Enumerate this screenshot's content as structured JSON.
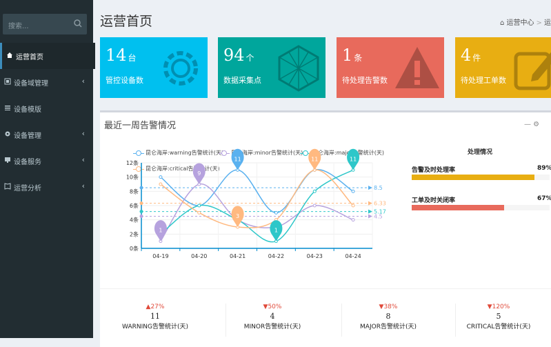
{
  "sidebar": {
    "search_placeholder": "搜索...",
    "items": [
      {
        "label": "运营首页",
        "icon": "home-icon",
        "chevron": ""
      },
      {
        "label": "设备域管理",
        "icon": "network-icon",
        "chevron": "‹"
      },
      {
        "label": "设备模版",
        "icon": "list-icon",
        "chevron": ""
      },
      {
        "label": "设备管理",
        "icon": "gear-icon",
        "chevron": "‹"
      },
      {
        "label": "设备服务",
        "icon": "monitor-icon",
        "chevron": "‹"
      },
      {
        "label": "运营分析",
        "icon": "book-icon",
        "chevron": "‹"
      }
    ]
  },
  "header": {
    "title": "运营首页",
    "breadcrumb": {
      "home": "运营中心",
      "sep": ">",
      "current": "运营"
    }
  },
  "stat_boxes": [
    {
      "num": "14",
      "unit": "台",
      "label": "管控设备数",
      "color": "#00c0ef",
      "icon": "gear-icon"
    },
    {
      "num": "94",
      "unit": "个",
      "label": "数据采集点",
      "color": "#00a69c",
      "icon": "polygon-icon"
    },
    {
      "num": "1",
      "unit": "条",
      "label": "待处理告警数",
      "color": "#e86a5c",
      "icon": "warning-icon"
    },
    {
      "num": "4",
      "unit": "件",
      "label": "待处理工单数",
      "color": "#e8ae12",
      "icon": "edit-icon"
    }
  ],
  "panel": {
    "title": "最近一周告警情况",
    "tools": "—  ⚙"
  },
  "progress": {
    "title": "处理情况",
    "items": [
      {
        "label": "告警及时处理率",
        "value": "89%",
        "fraction": 0.89,
        "color": "#e8ae12"
      },
      {
        "label": "工单及时关闭率",
        "value": "67%",
        "fraction": 0.67,
        "color": "#e86a5c"
      }
    ]
  },
  "stats": [
    {
      "pct": "▲27%",
      "pct_color": "#e04a3a",
      "value": "11",
      "name": "WARNING告警统计(天)"
    },
    {
      "pct": "▼50%",
      "pct_color": "#e04a3a",
      "value": "4",
      "name": "MINOR告警统计(天)"
    },
    {
      "pct": "▼38%",
      "pct_color": "#e04a3a",
      "value": "8",
      "name": "MAJOR告警统计(天)"
    },
    {
      "pct": "▼120%",
      "pct_color": "#e04a3a",
      "value": "5",
      "name": "CRITICAL告警统计(天)"
    }
  ],
  "chart_data": {
    "type": "line",
    "categories": [
      "04-19",
      "04-20",
      "04-21",
      "04-22",
      "04-23",
      "04-24"
    ],
    "ylim": [
      0,
      12
    ],
    "yticks": [
      "0条",
      "2条",
      "4条",
      "6条",
      "8条",
      "10条",
      "12条"
    ],
    "series": [
      {
        "name": "昆仑海岸:warning告警统计(天)",
        "color": "#5ab1ef",
        "values": [
          10,
          6,
          11,
          5,
          11,
          8
        ],
        "max_pin": "11",
        "avg": "8.5"
      },
      {
        "name": "昆仑海岸:minor告警统计(天)",
        "color": "#b6a2de",
        "values": [
          1,
          9,
          4,
          3,
          6,
          4
        ],
        "max_pin": "9",
        "min_pin": "1",
        "avg": "4.5"
      },
      {
        "name": "昆仑海岸:major告警统计(天)",
        "color": "#2ec7c9",
        "values": [
          2,
          6,
          4,
          1,
          8,
          11
        ],
        "max_pin": "11",
        "min_pin": "1",
        "avg": "5.17"
      },
      {
        "name": "昆仑海岸:critical告警统计(天)",
        "color": "#ffb980",
        "values": [
          9,
          5,
          3,
          4,
          11,
          6
        ],
        "max_pin": "11",
        "min_pin": "3",
        "avg": "6.33"
      }
    ]
  }
}
